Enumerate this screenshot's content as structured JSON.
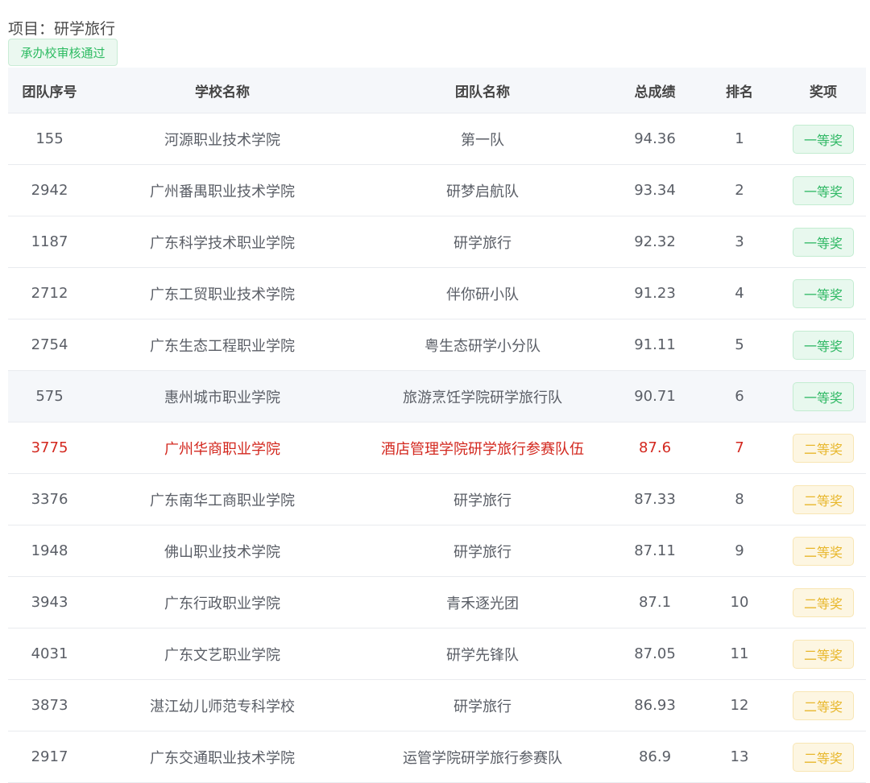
{
  "project": {
    "label": "项目：研学旅行"
  },
  "review_tag": "承办校审核通过",
  "columns": [
    "团队序号",
    "学校名称",
    "团队名称",
    "总成绩",
    "排名",
    "奖项"
  ],
  "rows": [
    {
      "id": "155",
      "school": "河源职业技术学院",
      "team": "第一队",
      "score": "94.36",
      "rank": "1",
      "award": "一等奖",
      "level": "first"
    },
    {
      "id": "2942",
      "school": "广州番禺职业技术学院",
      "team": "研梦启航队",
      "score": "93.34",
      "rank": "2",
      "award": "一等奖",
      "level": "first"
    },
    {
      "id": "1187",
      "school": "广东科学技术职业学院",
      "team": "研学旅行",
      "score": "92.32",
      "rank": "3",
      "award": "一等奖",
      "level": "first"
    },
    {
      "id": "2712",
      "school": "广东工贸职业技术学院",
      "team": "伴你研小队",
      "score": "91.23",
      "rank": "4",
      "award": "一等奖",
      "level": "first"
    },
    {
      "id": "2754",
      "school": "广东生态工程职业学院",
      "team": "粤生态研学小分队",
      "score": "91.11",
      "rank": "5",
      "award": "一等奖",
      "level": "first"
    },
    {
      "id": "575",
      "school": "惠州城市职业学院",
      "team": "旅游烹饪学院研学旅行队",
      "score": "90.71",
      "rank": "6",
      "award": "一等奖",
      "level": "first",
      "hover": true
    },
    {
      "id": "3775",
      "school": "广州华商职业学院",
      "team": "酒店管理学院研学旅行参赛队伍",
      "score": "87.6",
      "rank": "7",
      "award": "二等奖",
      "level": "second",
      "highlight": true
    },
    {
      "id": "3376",
      "school": "广东南华工商职业学院",
      "team": "研学旅行",
      "score": "87.33",
      "rank": "8",
      "award": "二等奖",
      "level": "second"
    },
    {
      "id": "1948",
      "school": "佛山职业技术学院",
      "team": "研学旅行",
      "score": "87.11",
      "rank": "9",
      "award": "二等奖",
      "level": "second"
    },
    {
      "id": "3943",
      "school": "广东行政职业学院",
      "team": "青禾逐光团",
      "score": "87.1",
      "rank": "10",
      "award": "二等奖",
      "level": "second"
    },
    {
      "id": "4031",
      "school": "广东文艺职业学院",
      "team": "研学先锋队",
      "score": "87.05",
      "rank": "11",
      "award": "二等奖",
      "level": "second"
    },
    {
      "id": "3873",
      "school": "湛江幼儿师范专科学校",
      "team": "研学旅行",
      "score": "86.93",
      "rank": "12",
      "award": "二等奖",
      "level": "second"
    },
    {
      "id": "2917",
      "school": "广东交通职业技术学院",
      "team": "运管学院研学旅行参赛队",
      "score": "86.9",
      "rank": "13",
      "award": "二等奖",
      "level": "second"
    }
  ]
}
